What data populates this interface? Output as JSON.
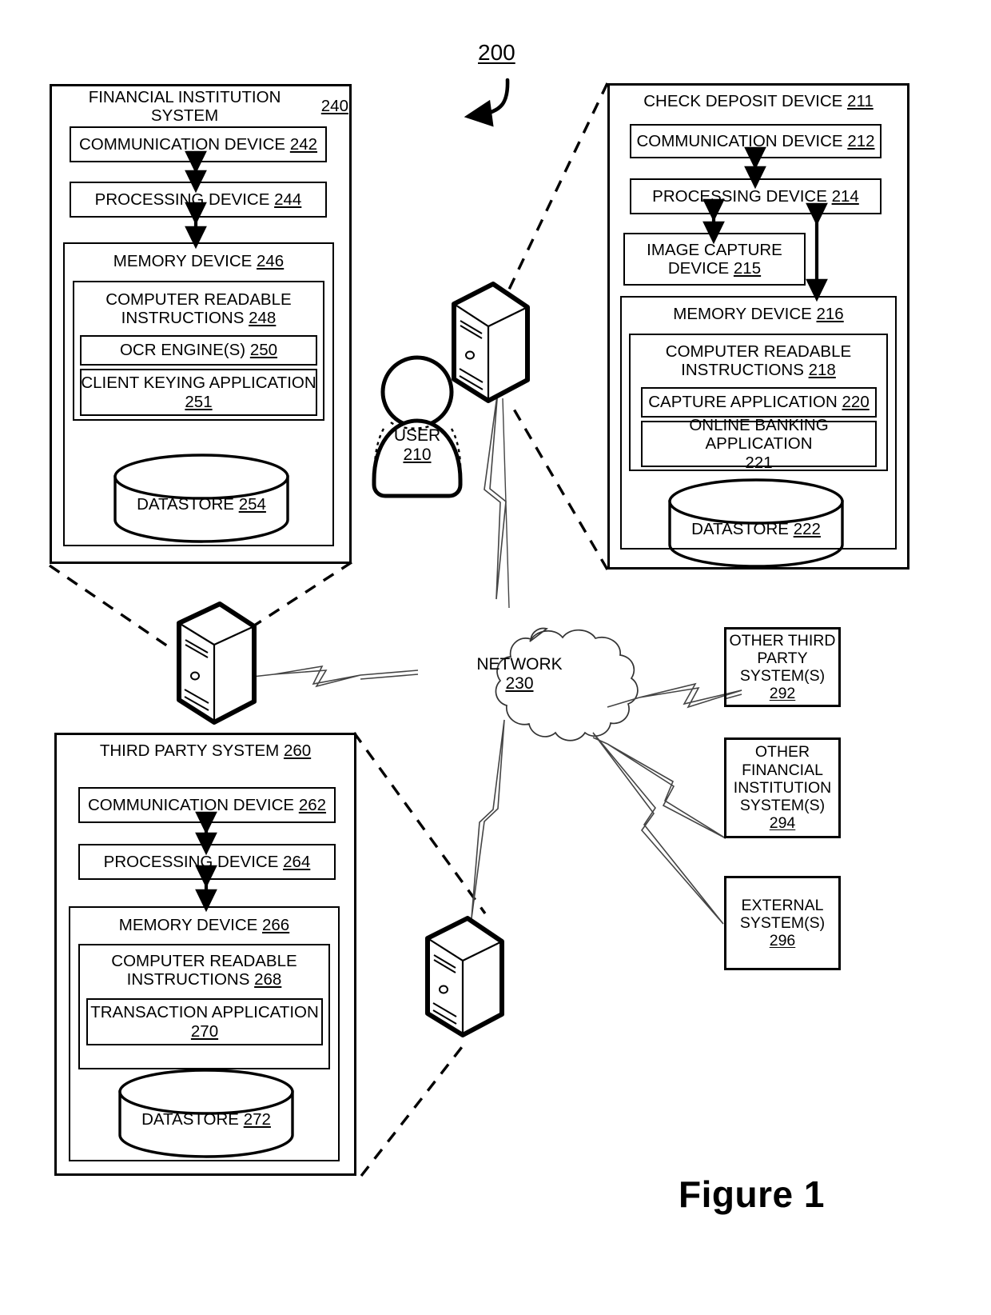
{
  "figure": {
    "caption": "Figure 1",
    "system_ref": "200"
  },
  "financial_institution_system": {
    "title": "FINANCIAL INSTITUTION SYSTEM",
    "ref": "240",
    "communication_device": {
      "title": "COMMUNICATION DEVICE",
      "ref": "242"
    },
    "processing_device": {
      "title": "PROCESSING DEVICE",
      "ref": "244"
    },
    "memory_device": {
      "title": "MEMORY DEVICE",
      "ref": "246"
    },
    "computer_readable_instructions": {
      "title": "COMPUTER READABLE INSTRUCTIONS",
      "ref": "248"
    },
    "ocr_engines": {
      "title": "OCR ENGINE(S)",
      "ref": "250"
    },
    "client_keying_application": {
      "title": "CLIENT KEYING APPLICATION",
      "ref": "251"
    },
    "datastore": {
      "title": "DATASTORE",
      "ref": "254"
    }
  },
  "check_deposit_device": {
    "title": "CHECK DEPOSIT DEVICE",
    "ref": "211",
    "communication_device": {
      "title": "COMMUNICATION DEVICE",
      "ref": "212"
    },
    "processing_device": {
      "title": "PROCESSING DEVICE",
      "ref": "214"
    },
    "image_capture_device": {
      "title": "IMAGE CAPTURE DEVICE",
      "ref": "215"
    },
    "memory_device": {
      "title": "MEMORY DEVICE",
      "ref": "216"
    },
    "computer_readable_instructions": {
      "title": "COMPUTER READABLE INSTRUCTIONS",
      "ref": "218"
    },
    "capture_application": {
      "title": "CAPTURE APPLICATION",
      "ref": "220"
    },
    "online_banking_application": {
      "title": "ONLINE BANKING APPLICATION",
      "ref": "221"
    },
    "datastore": {
      "title": "DATASTORE",
      "ref": "222"
    }
  },
  "third_party_system": {
    "title": "THIRD PARTY SYSTEM",
    "ref": "260",
    "communication_device": {
      "title": "COMMUNICATION DEVICE",
      "ref": "262"
    },
    "processing_device": {
      "title": "PROCESSING DEVICE",
      "ref": "264"
    },
    "memory_device": {
      "title": "MEMORY DEVICE",
      "ref": "266"
    },
    "computer_readable_instructions": {
      "title": "COMPUTER READABLE INSTRUCTIONS",
      "ref": "268"
    },
    "transaction_application": {
      "title": "TRANSACTION APPLICATION",
      "ref": "270"
    },
    "datastore": {
      "title": "DATASTORE",
      "ref": "272"
    }
  },
  "user": {
    "title": "USER",
    "ref": "210"
  },
  "network": {
    "title": "NETWORK",
    "ref": "230"
  },
  "other_systems": [
    {
      "title": "OTHER THIRD PARTY SYSTEM(S)",
      "ref": "292"
    },
    {
      "title": "OTHER FINANCIAL INSTITUTION SYSTEM(S)",
      "ref": "294"
    },
    {
      "title": "EXTERNAL SYSTEM(S)",
      "ref": "296"
    }
  ],
  "icons": {
    "server_left": "server-tower-icon",
    "server_user": "server-tower-icon",
    "server_bottom": "server-tower-icon",
    "user_avatar": "user-person-icon",
    "datastore_cylinder": "database-cylinder-icon",
    "network_cloud": "cloud-icon",
    "lightning": "lightning-bolt-icon"
  }
}
